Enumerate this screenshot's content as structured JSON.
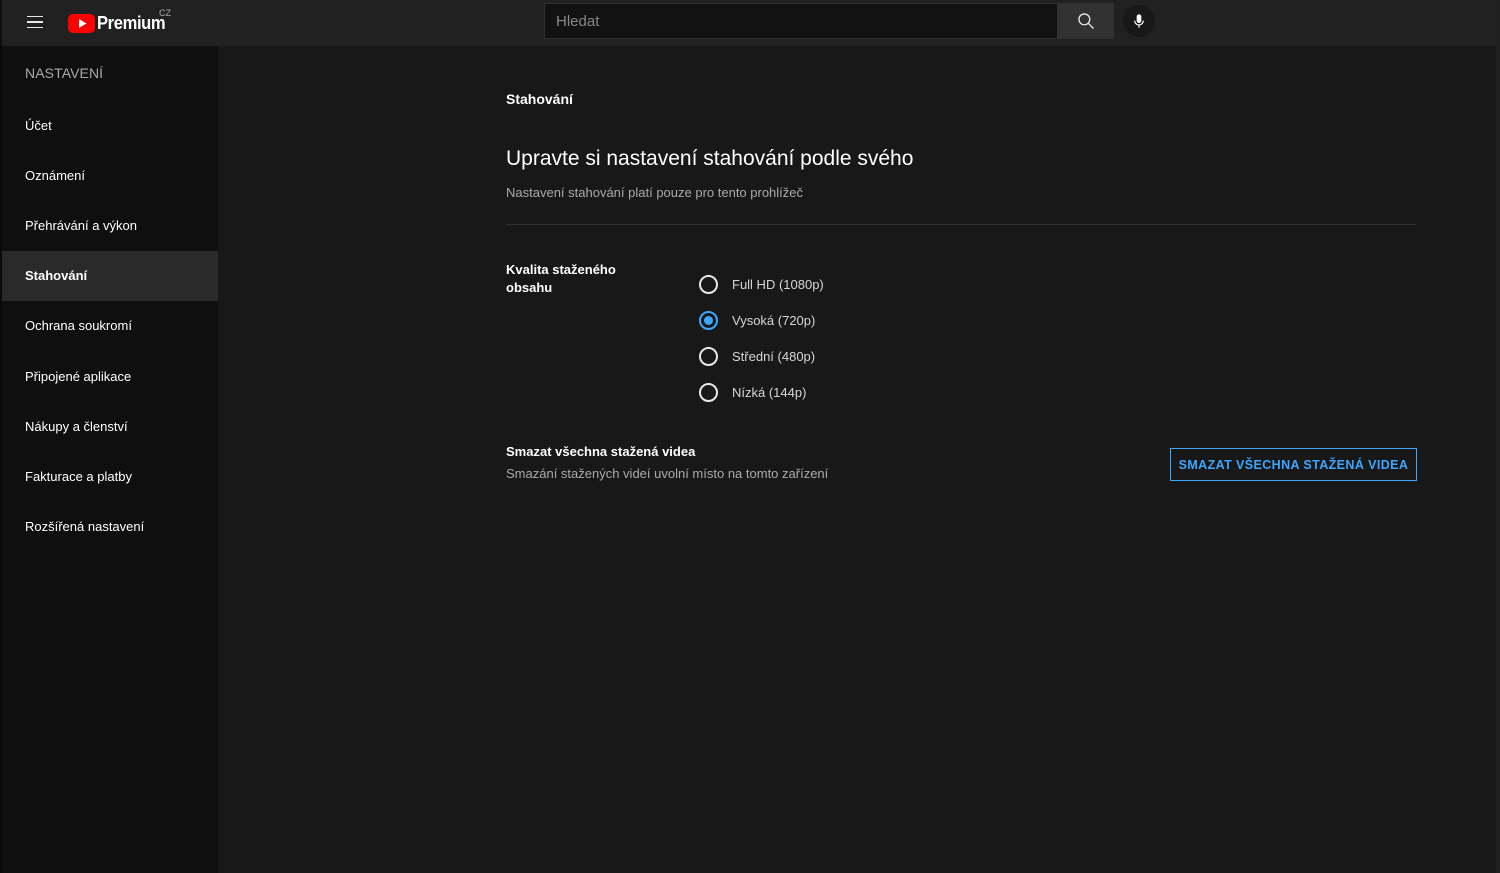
{
  "header": {
    "menu_icon": "hamburger-icon",
    "logo_text": "Premium",
    "logo_country": "CZ",
    "search": {
      "placeholder": "Hledat",
      "value": ""
    },
    "search_icon": "search-icon",
    "mic_icon": "microphone-icon"
  },
  "sidebar": {
    "title": "NASTAVENÍ",
    "items": [
      {
        "label": "Účet",
        "active": false
      },
      {
        "label": "Oznámení",
        "active": false
      },
      {
        "label": "Přehrávání a výkon",
        "active": false
      },
      {
        "label": "Stahování",
        "active": true
      },
      {
        "label": "Ochrana soukromí",
        "active": false
      },
      {
        "label": "Připojené aplikace",
        "active": false
      },
      {
        "label": "Nákupy a členství",
        "active": false
      },
      {
        "label": "Fakturace a platby",
        "active": false
      },
      {
        "label": "Rozšířená nastavení",
        "active": false
      }
    ]
  },
  "main": {
    "section_label": "Stahování",
    "headline": "Upravte si nastavení stahování podle svého",
    "subtext": "Nastavení stahování platí pouze pro tento prohlížeč",
    "quality": {
      "label": "Kvalita staženého obsahu",
      "options": [
        {
          "label": "Full HD (1080p)",
          "checked": false
        },
        {
          "label": "Vysoká (720p)",
          "checked": true
        },
        {
          "label": "Střední (480p)",
          "checked": false
        },
        {
          "label": "Nízká (144p)",
          "checked": false
        }
      ]
    },
    "delete": {
      "title": "Smazat všechna stažená videa",
      "description": "Smazání stažených videí uvolní místo na tomto zařízení",
      "button_label": "SMAZAT VŠECHNA STAŽENÁ VIDEA"
    }
  },
  "colors": {
    "accent": "#3ea6ff",
    "logo_red": "#ff0000",
    "background": "#181818",
    "sidebar_bg": "#0f0f0f",
    "header_bg": "#212121"
  }
}
